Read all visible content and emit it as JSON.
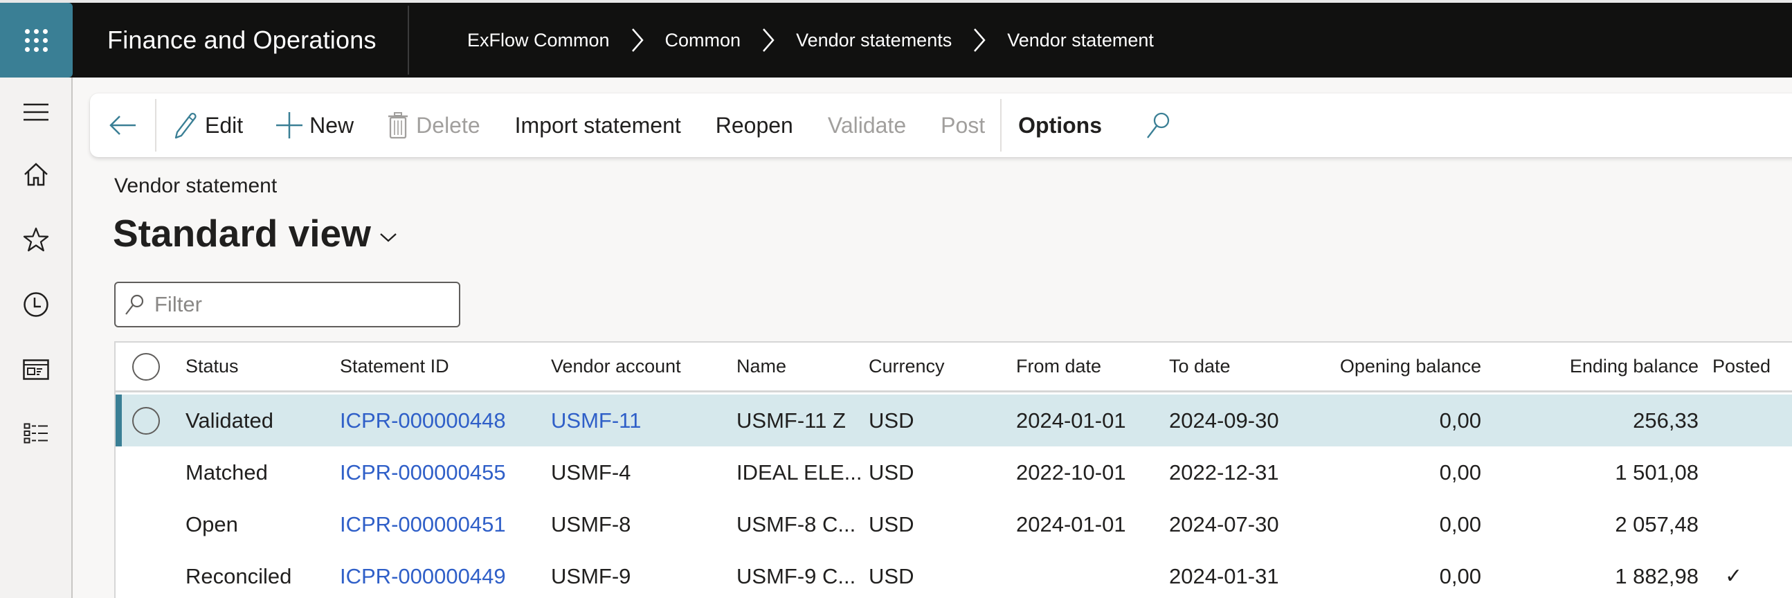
{
  "topbar": {
    "app_title": "Finance and Operations",
    "launcher_icon": "app-launcher-waffle-icon",
    "breadcrumb": [
      "ExFlow Common",
      "Common",
      "Vendor statements",
      "Vendor statement"
    ]
  },
  "sidebar": {
    "items": [
      {
        "name": "menu",
        "icon": "hamburger-icon"
      },
      {
        "name": "home",
        "icon": "home-icon"
      },
      {
        "name": "favorites",
        "icon": "star-icon"
      },
      {
        "name": "recent",
        "icon": "clock-icon"
      },
      {
        "name": "workspaces",
        "icon": "workspace-icon"
      },
      {
        "name": "modules",
        "icon": "list-icon"
      }
    ]
  },
  "toolbar": {
    "back_icon": "back-arrow-icon",
    "edit": "Edit",
    "new": "New",
    "delete": "Delete",
    "import_statement": "Import statement",
    "reopen": "Reopen",
    "validate": "Validate",
    "post": "Post",
    "options": "Options",
    "search_icon": "search-icon"
  },
  "page": {
    "caption": "Vendor statement",
    "view_name": "Standard view"
  },
  "filter": {
    "placeholder": "Filter",
    "value": ""
  },
  "grid": {
    "columns": [
      "Status",
      "Statement ID",
      "Vendor account",
      "Name",
      "Currency",
      "From date",
      "To date",
      "Opening balance",
      "Ending balance",
      "Posted"
    ],
    "rows": [
      {
        "selected": true,
        "status": "Validated",
        "statement_id": "ICPR-000000448",
        "vendor_account": "USMF-11",
        "vendor_is_link": true,
        "name": "USMF-11 Z",
        "currency": "USD",
        "from_date": "2024-01-01",
        "to_date": "2024-09-30",
        "opening_balance": "0,00",
        "ending_balance": "256,33",
        "posted": false
      },
      {
        "selected": false,
        "status": "Matched",
        "statement_id": "ICPR-000000455",
        "vendor_account": "USMF-4",
        "vendor_is_link": false,
        "name": "IDEAL ELE...",
        "currency": "USD",
        "from_date": "2022-10-01",
        "to_date": "2022-12-31",
        "opening_balance": "0,00",
        "ending_balance": "1 501,08",
        "posted": false
      },
      {
        "selected": false,
        "status": "Open",
        "statement_id": "ICPR-000000451",
        "vendor_account": "USMF-8",
        "vendor_is_link": false,
        "name": "USMF-8 C...",
        "currency": "USD",
        "from_date": "2024-01-01",
        "to_date": "2024-07-30",
        "opening_balance": "0,00",
        "ending_balance": "2 057,48",
        "posted": false
      },
      {
        "selected": false,
        "status": "Reconciled",
        "statement_id": "ICPR-000000449",
        "vendor_account": "USMF-9",
        "vendor_is_link": false,
        "name": "USMF-9 C...",
        "currency": "USD",
        "from_date": "",
        "to_date": "2024-01-31",
        "opening_balance": "0,00",
        "ending_balance": "1 882,98",
        "posted": true
      }
    ],
    "posted_mark": "✓"
  },
  "colors": {
    "accent": "#3a7f95",
    "topbar_bg": "#111110",
    "selected_row_bg": "#d6e8ec",
    "link": "#2f5fc8",
    "disabled_text": "#a19f9d"
  }
}
